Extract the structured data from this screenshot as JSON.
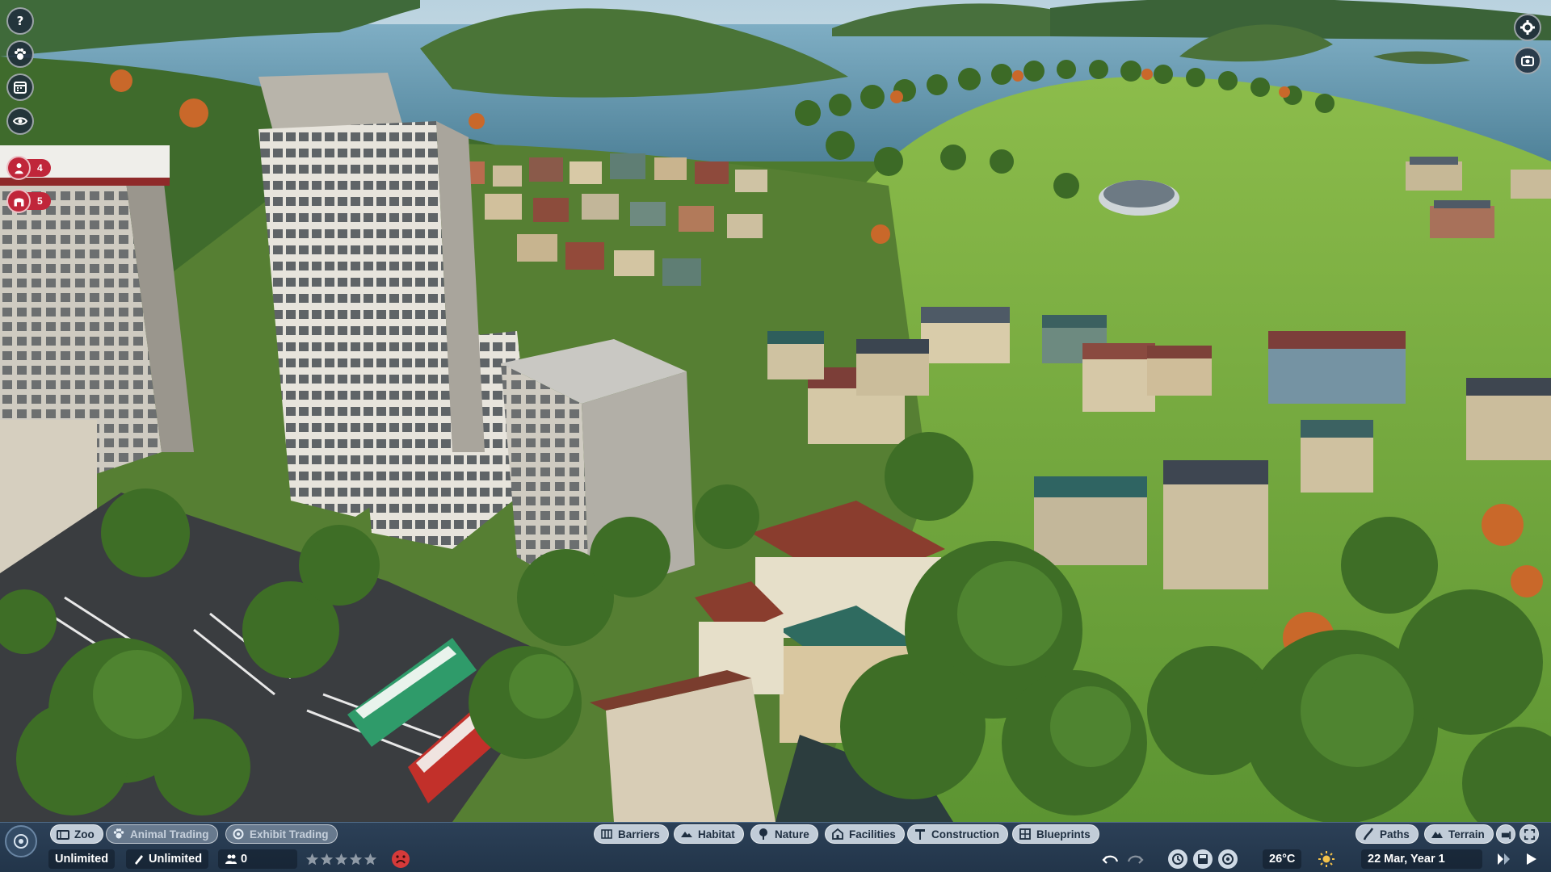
{
  "left_column": {
    "alerts": [
      {
        "icon": "guest-alert-icon",
        "count": "4"
      },
      {
        "icon": "habitat-alert-icon",
        "count": "5"
      }
    ]
  },
  "toolbar_left": {
    "zoo_label": "Zoo",
    "animal_trading_label": "Animal Trading",
    "exhibit_trading_label": "Exhibit Trading"
  },
  "toolbar_center": {
    "items": [
      {
        "label": "Barriers",
        "icon": "barrier-icon"
      },
      {
        "label": "Habitat",
        "icon": "habitat-icon"
      },
      {
        "label": "Nature",
        "icon": "nature-icon"
      },
      {
        "label": "Facilities",
        "icon": "facilities-icon"
      },
      {
        "label": "Construction",
        "icon": "construction-icon"
      },
      {
        "label": "Blueprints",
        "icon": "blueprints-icon"
      }
    ]
  },
  "toolbar_right": {
    "paths_label": "Paths",
    "terrain_label": "Terrain"
  },
  "status": {
    "money": "Unlimited",
    "research": "Unlimited",
    "guests": "0",
    "rating_stars": 0,
    "rating_max": 5,
    "temperature": "26°C",
    "date": "22 Mar, Year 1"
  },
  "colors": {
    "bar": "#2c4057",
    "alert_red": "#c0263a",
    "grass": "#5b8f2f",
    "water": "#6f9fb8"
  }
}
